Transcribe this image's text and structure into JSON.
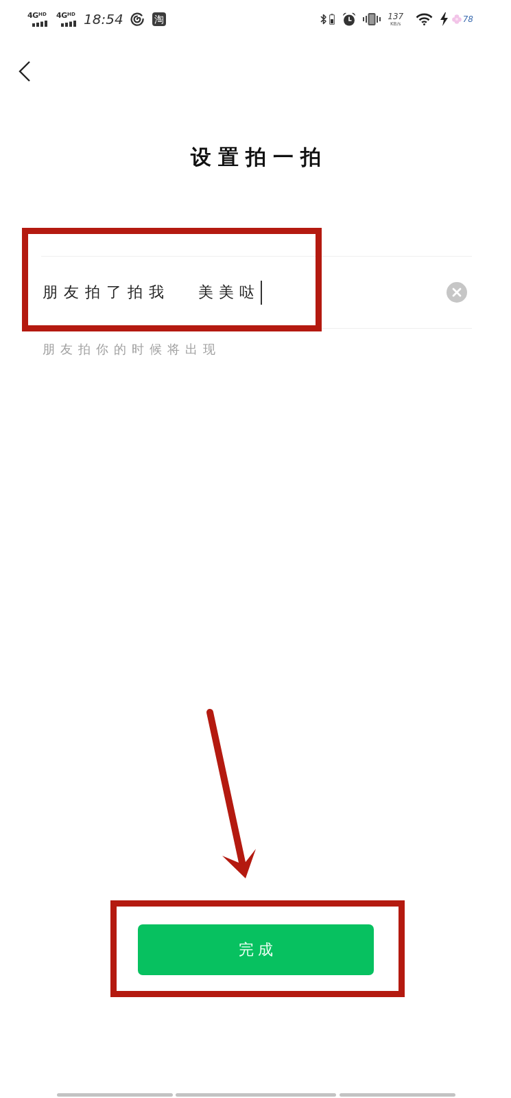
{
  "status_bar": {
    "signals": [
      {
        "label": "4G",
        "badge": "HD"
      },
      {
        "label": "4G",
        "badge": "HD"
      }
    ],
    "time": "18:54",
    "notifications": [
      {
        "kind": "swirl"
      },
      {
        "kind": "tile",
        "text": "淘"
      }
    ],
    "speed": "137",
    "speed_unit": "KB/s",
    "battery": "78"
  },
  "header": {
    "title": "设置拍一拍"
  },
  "pat_field": {
    "prefix": "朋友拍了拍我",
    "value": "美美哒",
    "focused": true,
    "highlighted": true,
    "hint": "朋友拍你的时候将出现"
  },
  "done_button": {
    "label": "完成",
    "highlighted": true,
    "arrow": true
  }
}
